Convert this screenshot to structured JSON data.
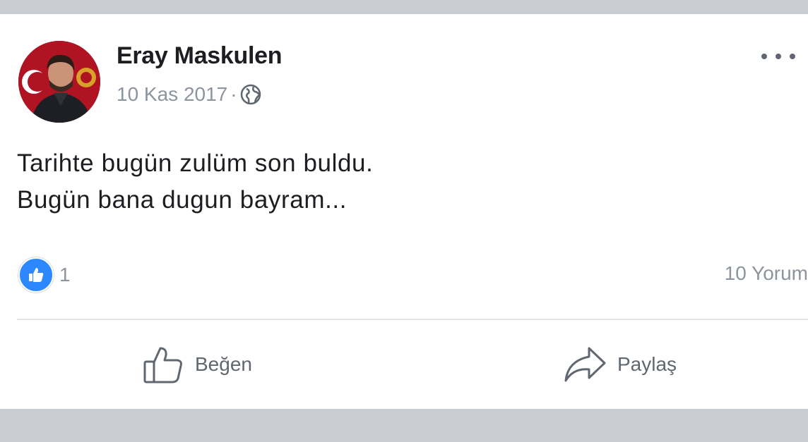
{
  "post": {
    "author": "Eray Maskulen",
    "date": "10 Kas 2017",
    "separator": "·",
    "audience_icon": "globe-icon",
    "text_lines": [
      "Tarihte bugün zulüm son buldu.",
      "Bugün bana dugun bayram..."
    ],
    "reactions": {
      "icon": "like-icon",
      "count": "1"
    },
    "comments": "10 Yorum"
  },
  "actions": {
    "like_label": "Beğen",
    "share_label": "Paylaş"
  },
  "colors": {
    "accent": "#2d88ff",
    "text_primary": "#1c1e21",
    "text_secondary": "#8d949e",
    "background": "#c9ccd3"
  }
}
